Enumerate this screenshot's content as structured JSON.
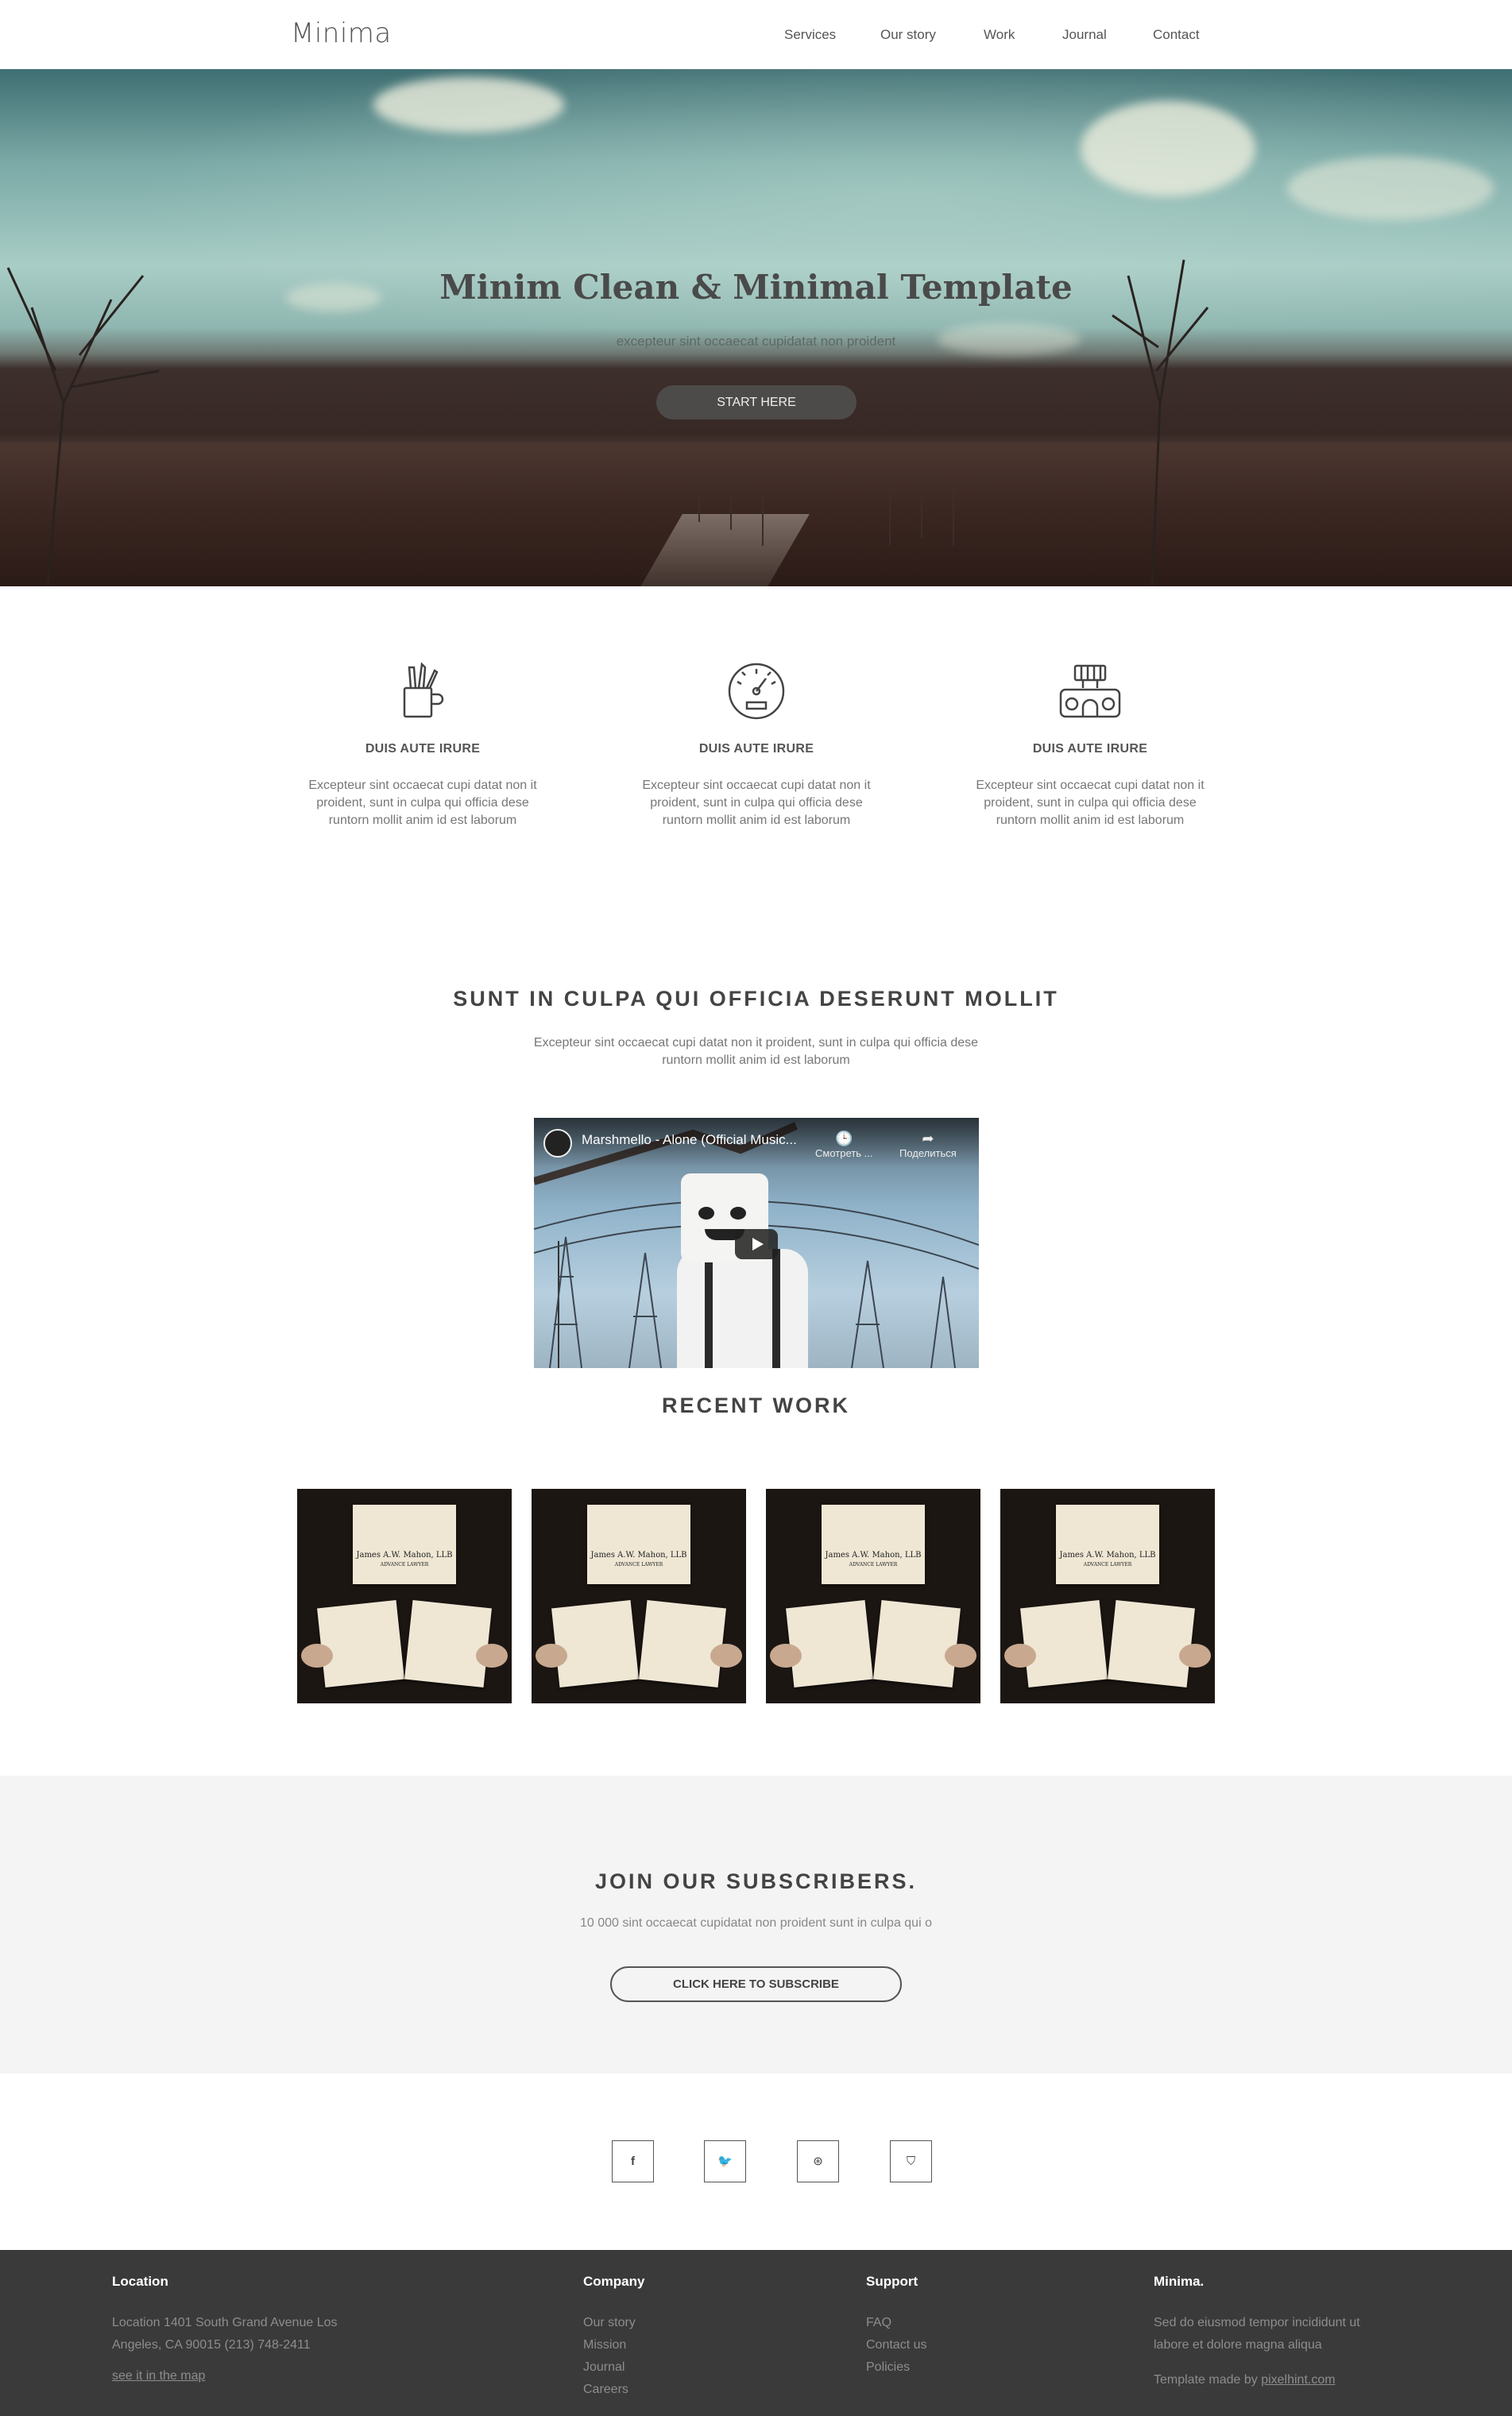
{
  "nav": {
    "logo": "Minima",
    "items": [
      {
        "label": "Services"
      },
      {
        "label": "Our story"
      },
      {
        "label": "Work"
      },
      {
        "label": "Journal"
      },
      {
        "label": "Contact"
      }
    ]
  },
  "hero": {
    "title": "Minim Clean & Minimal Template",
    "subtitle": "excepteur sint occaecat cupidatat non proident",
    "button": "START HERE"
  },
  "features": [
    {
      "icon": "pencil-cup-icon",
      "title": "DUIS AUTE IRURE",
      "text": "Excepteur sint occaecat cupi datat non it proident, sunt in culpa qui officia dese runtorn mollit anim id est laborum"
    },
    {
      "icon": "gauge-icon",
      "title": "DUIS AUTE IRURE",
      "text": "Excepteur sint occaecat cupi datat non it proident, sunt in culpa qui officia dese runtorn mollit anim id est laborum"
    },
    {
      "icon": "camera-icon",
      "title": "DUIS AUTE IRURE",
      "text": "Excepteur sint occaecat cupi datat non it proident, sunt in culpa qui officia dese runtorn mollit anim id est laborum"
    }
  ],
  "intro": {
    "title": "SUNT IN CULPA QUI OFFICIA DESERUNT MOLLIT",
    "text": "Excepteur sint occaecat cupi datat non it proident, sunt in culpa qui officia dese runtorn mollit anim id est laborum"
  },
  "video": {
    "title": "Marshmello - Alone (Official Music...",
    "watch_label": "Смотреть ...",
    "share_label": "Поделиться"
  },
  "work": {
    "title": "RECENT WORK",
    "card_name": "James A.W. Mahon, LLB",
    "card_sub": "ADVANCE LAWYER"
  },
  "subscribe": {
    "title": "JOIN OUR SUBSCRIBERS.",
    "text": "10 000 sint occaecat cupidatat non proident sunt in culpa qui o",
    "button": "CLICK HERE TO SUBSCRIBE"
  },
  "social": [
    {
      "icon": "facebook-icon",
      "glyph": "f"
    },
    {
      "icon": "twitter-icon",
      "glyph": "🐦"
    },
    {
      "icon": "dribbble-icon",
      "glyph": "⊛"
    },
    {
      "icon": "html5-icon",
      "glyph": "⛉"
    }
  ],
  "footer": {
    "location": {
      "title": "Location",
      "address": "Location 1401 South Grand Avenue Los Angeles, CA 90015 (213) 748-2411",
      "map_link": "see it in the map"
    },
    "company": {
      "title": "Company",
      "items": [
        "Our story",
        "Mission",
        "Journal",
        "Careers"
      ]
    },
    "support": {
      "title": "Support",
      "items": [
        "FAQ",
        "Contact us",
        "Policies"
      ]
    },
    "brand": {
      "title": "Minima.",
      "text": "Sed do eiusmod tempor incididunt ut labore et dolore magna aliqua",
      "credit_prefix": "Template made by ",
      "credit_link": "pixelhint.com"
    }
  }
}
